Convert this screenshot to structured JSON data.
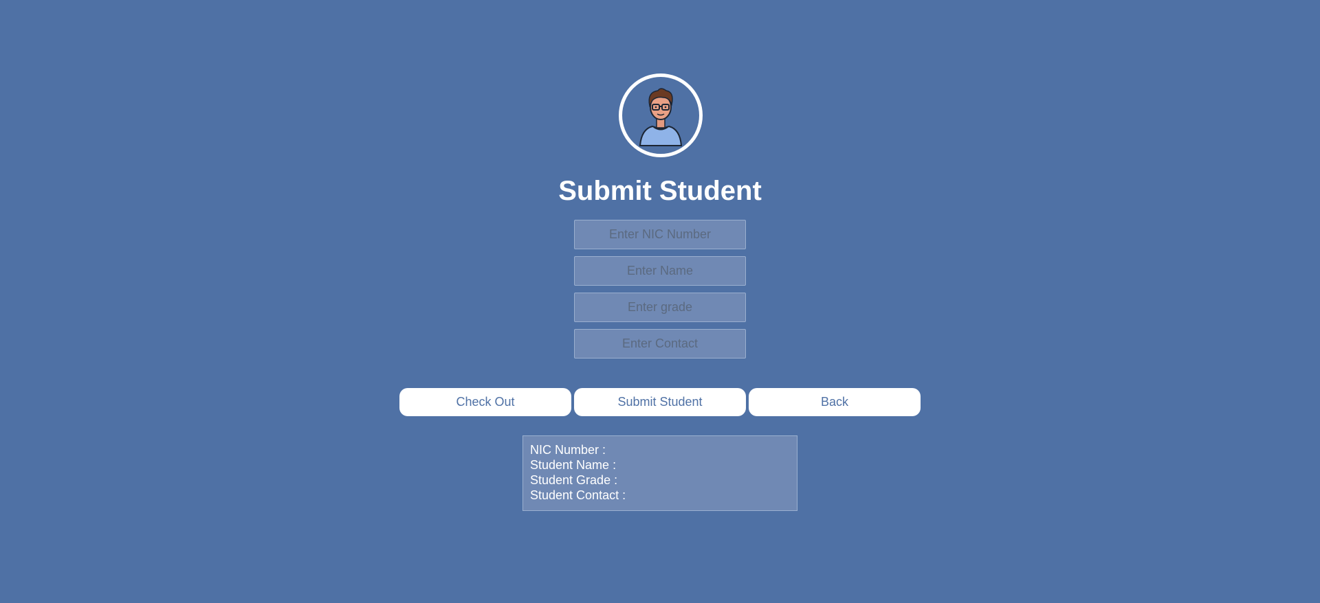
{
  "header": {
    "avatar_icon": "student-avatar-icon",
    "title": "Submit Student"
  },
  "form": {
    "nic_placeholder": "Enter NIC Number",
    "name_placeholder": "Enter Name",
    "grade_placeholder": "Enter grade",
    "contact_placeholder": "Enter Contact"
  },
  "actions": {
    "checkout_label": "Check Out",
    "submit_label": "Submit Student",
    "back_label": "Back"
  },
  "result": {
    "nic_label": "NIC Number :",
    "name_label": "Student Name :",
    "grade_label": "Student Grade :",
    "contact_label": "Student Contact :"
  },
  "colors": {
    "background": "#4f71a5",
    "field_background": "#7089b4",
    "button_background": "#ffffff",
    "button_text": "#4f71a5"
  }
}
